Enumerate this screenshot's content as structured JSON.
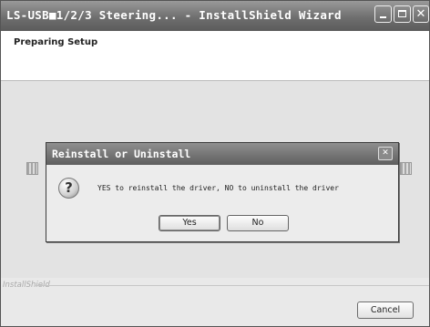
{
  "window": {
    "title": "LS-USB■1/2/3 Steering... - InstallShield Wizard",
    "close_glyph": "✕"
  },
  "header": {
    "title": "Preparing Setup"
  },
  "footer": {
    "brand": "InstallShield",
    "cancel_label": "Cancel"
  },
  "dialog": {
    "title": "Reinstall or Uninstall",
    "close_glyph": "✕",
    "icon": "question-icon",
    "icon_glyph": "?",
    "message": "YES to reinstall the driver, NO to uninstall the driver",
    "yes_label": "Yes",
    "no_label": "No"
  }
}
